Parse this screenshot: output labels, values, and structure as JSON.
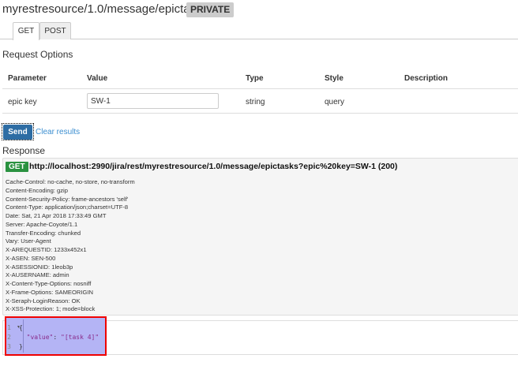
{
  "header": {
    "title": "myrestresource/1.0/message/epictasks",
    "badge": "PRIVATE"
  },
  "tabs": [
    {
      "label": "GET"
    },
    {
      "label": "POST"
    }
  ],
  "request": {
    "title": "Request Options",
    "columns": [
      "Parameter",
      "Value",
      "Type",
      "Style",
      "Description"
    ],
    "row": {
      "parameter": "epic key",
      "value": "SW-1",
      "type": "string",
      "style": "query",
      "description": ""
    }
  },
  "actions": {
    "send": "Send",
    "clear": "Clear results"
  },
  "response": {
    "title": "Response",
    "method": "GET",
    "url": "http://localhost:2990/jira/rest/myrestresource/1.0/message/epictasks?epic%20key=SW-1 (200)",
    "headers": [
      "Cache-Control: no-cache, no-store, no-transform",
      "Content-Encoding: gzip",
      "Content-Security-Policy: frame-ancestors 'self'",
      "Content-Type: application/json;charset=UTF-8",
      "Date: Sat, 21 Apr 2018 17:33:49 GMT",
      "Server: Apache-Coyote/1.1",
      "Transfer-Encoding: chunked",
      "Vary: User-Agent",
      "X-AREQUESTID: 1233x452x1",
      "X-ASEN: SEN-500",
      "X-ASESSIONID: 1leob3p",
      "X-AUSERNAME: admin",
      "X-Content-Type-Options: nosniff",
      "X-Frame-Options: SAMEORIGIN",
      "X-Seraph-LoginReason: OK",
      "X-XSS-Protection: 1; mode=block"
    ],
    "body": {
      "line_numbers": [
        "1",
        "2",
        "3"
      ],
      "open": "{",
      "key": "\"value\"",
      "colon": ": ",
      "val": "\"[task 4]\"",
      "close": "}"
    }
  },
  "colors": {
    "send": "#2e6da4",
    "get_badge": "#2a9240",
    "selection": "#b4b4f5",
    "highlight_border": "#e00000"
  }
}
